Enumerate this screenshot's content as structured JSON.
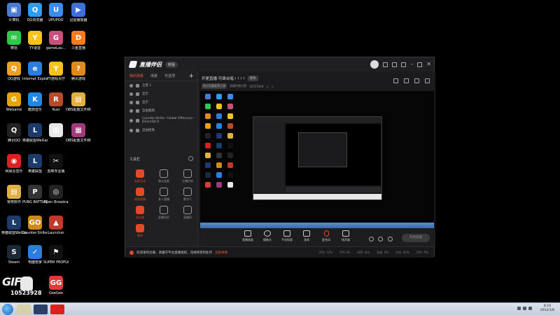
{
  "desktop_icons": [
    {
      "label": "计算机",
      "icon": "computer-icon",
      "color": "#4a7bd0",
      "glyph": "▣"
    },
    {
      "label": "QQ浏览器",
      "icon": "qq-browser-icon",
      "color": "#2b9cf2",
      "glyph": "Q"
    },
    {
      "label": "UPUPOO",
      "icon": "upupoo-icon",
      "color": "#3a8df0",
      "glyph": "U"
    },
    {
      "label": "迅雷播放器",
      "icon": "player-icon",
      "color": "#3d6fe0",
      "glyph": "▶"
    },
    {
      "label": "微信",
      "icon": "wechat-icon",
      "color": "#2ec84a",
      "glyph": "✉"
    },
    {
      "label": "YY语音",
      "icon": "yy-icon",
      "color": "#f6c21c",
      "glyph": "Y"
    },
    {
      "label": "gameLau...",
      "icon": "game-launcher-icon",
      "color": "#c94f7c",
      "glyph": "G"
    },
    {
      "label": "斗鱼直播",
      "icon": "douyu-icon",
      "color": "#ff7a1a",
      "glyph": "D"
    },
    {
      "label": "QQ游戏",
      "icon": "qq-game-icon",
      "color": "#f0a020",
      "glyph": "Q"
    },
    {
      "label": "Internet Explorer",
      "icon": "ie-icon",
      "color": "#2b7de0",
      "glyph": "e"
    },
    {
      "label": "YY游戏大厅",
      "icon": "yy-game-icon",
      "color": "#f6c21c",
      "glyph": "Y"
    },
    {
      "label": "腾讯游戏",
      "icon": "tencent-game-icon",
      "color": "#e08a1e",
      "glyph": "?"
    },
    {
      "label": "WeGame",
      "icon": "wegame-icon",
      "color": "#e8a200",
      "glyph": "G"
    },
    {
      "label": "酷狗音乐",
      "icon": "kugou-icon",
      "color": "#1e88e5",
      "glyph": "K"
    },
    {
      "label": "Rust",
      "icon": "rust-icon",
      "color": "#b84a2a",
      "glyph": "R"
    },
    {
      "label": "OBS配置文件转换",
      "icon": "folder-icon",
      "color": "#e0b040",
      "glyph": "▤"
    },
    {
      "label": "腾讯QQ",
      "icon": "qq-icon",
      "color": "#222222",
      "glyph": "Q"
    },
    {
      "label": "英雄联盟WeGame版",
      "icon": "lol-icon",
      "color": "#1c3b6a",
      "glyph": "L"
    },
    {
      "label": "",
      "icon": "file-icon",
      "color": "#e8e8e8",
      "glyph": "▥"
    },
    {
      "label": "OBS配置文件转换.rar",
      "icon": "rar-icon",
      "color": "#a03a7a",
      "glyph": "▦"
    },
    {
      "label": "网易云音乐",
      "icon": "netease-music-icon",
      "color": "#e02020",
      "glyph": "◉"
    },
    {
      "label": "英雄联盟",
      "icon": "lol-client-icon",
      "color": "#1c3b6a",
      "glyph": "L"
    },
    {
      "label": "剪映专业版",
      "icon": "capcut-icon",
      "color": "#111111",
      "glyph": "✂"
    },
    {
      "label": "",
      "icon": "",
      "color": "",
      "glyph": ""
    },
    {
      "label": "常用软件",
      "icon": "folder-software-icon",
      "color": "#e0b040",
      "glyph": "▤"
    },
    {
      "label": "PUBG BATTLEGR...",
      "icon": "pubg-icon",
      "color": "#333333",
      "glyph": "P"
    },
    {
      "label": "Open Broadcast...",
      "icon": "obs-icon",
      "color": "#222222",
      "glyph": "◎"
    },
    {
      "label": "",
      "icon": "",
      "color": "",
      "glyph": ""
    },
    {
      "label": "英雄联盟WeGame...",
      "icon": "lol-wegame-icon",
      "color": "#1c3b6a",
      "glyph": "L"
    },
    {
      "label": "Counter-Strike Global Off...",
      "icon": "csgo-icon",
      "color": "#d08a1a",
      "glyph": "GO"
    },
    {
      "label": "Launcher",
      "icon": "launcher-icon",
      "color": "#c0392b",
      "glyph": "▲"
    },
    {
      "label": "",
      "icon": "",
      "color": "",
      "glyph": ""
    },
    {
      "label": "Steam",
      "icon": "steam-icon",
      "color": "#1b2838",
      "glyph": "S"
    },
    {
      "label": "电脑管家",
      "icon": "pc-manager-icon",
      "color": "#2b7de0",
      "glyph": "✓"
    },
    {
      "label": "SUPER PEOPLE CBT",
      "icon": "super-people-icon",
      "color": "#111111",
      "glyph": "⚑"
    },
    {
      "label": "",
      "icon": "",
      "color": "",
      "glyph": ""
    },
    {
      "label": "",
      "icon": "",
      "color": "",
      "glyph": ""
    },
    {
      "label": "",
      "icon": "",
      "color": "",
      "glyph": ""
    },
    {
      "label": "GeeGee",
      "icon": "geegee-icon",
      "color": "#e03a3a",
      "glyph": "GG"
    }
  ],
  "app": {
    "name": "直播伴侣",
    "version": "新版",
    "left_tabs": [
      "我的场景",
      "场景",
      "可选项"
    ],
    "sources": [
      {
        "label": "全景 1"
      },
      {
        "label": "显示"
      },
      {
        "label": "显示"
      },
      {
        "label": "自由截图"
      },
      {
        "label": "Counter-Strike: Global Offensive - Direct3D 9"
      },
      {
        "label": "自由抠像"
      }
    ],
    "tools_header": "工具栏",
    "tools": [
      {
        "label": "连麦互动",
        "red": true,
        "icon": "linkmic-icon"
      },
      {
        "label": "观众连麦",
        "red": false,
        "icon": "audience-icon"
      },
      {
        "label": "主播任务",
        "red": false,
        "icon": "task-icon"
      },
      {
        "label": "视频直播",
        "red": true,
        "icon": "video-live-icon"
      },
      {
        "label": "多人直播",
        "red": false,
        "icon": "multi-live-icon"
      },
      {
        "label": "数字人",
        "red": false,
        "icon": "digital-icon"
      },
      {
        "label": "送礼物",
        "red": true,
        "icon": "gift-icon"
      },
      {
        "label": "直播伴侣",
        "red": false,
        "icon": "companion-icon"
      },
      {
        "label": "直播间",
        "red": false,
        "icon": "room-icon"
      },
      {
        "label": "更多",
        "red": true,
        "icon": "more-icon"
      }
    ],
    "stream_title": "开更直播  可昂合唱 ! ! ! !",
    "title_tag": "修改",
    "chip": "热点话题推荐之旅",
    "room_label": "直播间数位置",
    "room_id": "10523928",
    "controls": [
      {
        "label": "直播画面",
        "icon": "screen-icon"
      },
      {
        "label": "摄像头",
        "icon": "camera-icon"
      },
      {
        "label": "手机投屏",
        "icon": "phone-icon"
      },
      {
        "label": "游戏",
        "icon": "game-icon"
      },
      {
        "label": "麦克风",
        "icon": "mic-icon"
      },
      {
        "label": "扬声器",
        "icon": "speaker-icon"
      }
    ],
    "start_button": "开始直播",
    "status_message": "欢迎来到主播，请遵守平台直播规则，违规将受到处罚",
    "status_link": "违规详情",
    "stats": [
      "CPU: 12%",
      "FPS: 60",
      "码率: 0kb",
      "丢帧: 0%",
      "内存: 40%",
      "GPU: 9%"
    ]
  },
  "watermark": {
    "brand": "GIF",
    "number": "10523928"
  },
  "taskbar": {
    "time": "8:19",
    "date": "2022/1/8"
  }
}
